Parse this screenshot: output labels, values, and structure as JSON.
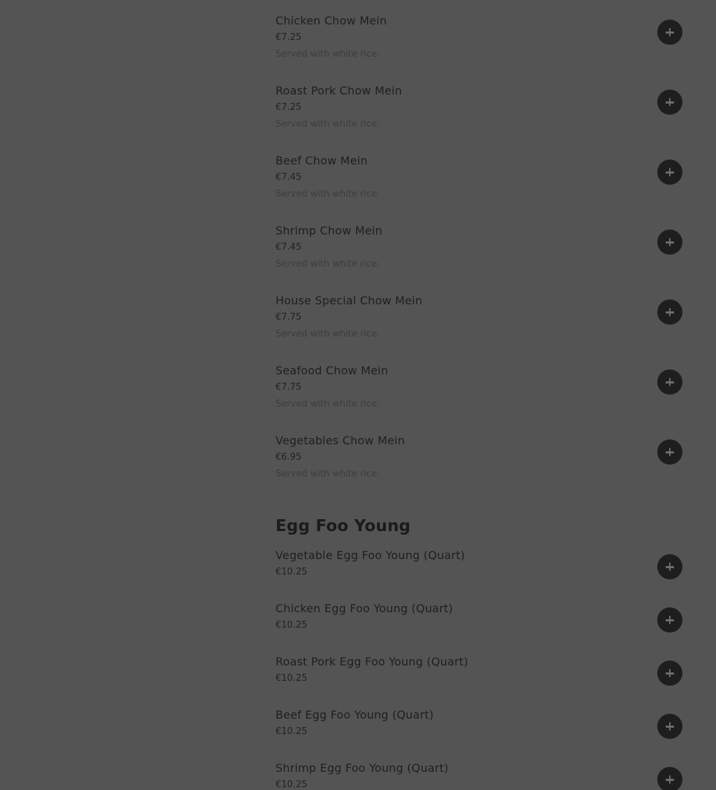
{
  "chow_mein": {
    "items": [
      {
        "name": "Chicken Chow Mein",
        "price": "€7.25",
        "description": "Served with white rice."
      },
      {
        "name": "Roast Pork Chow Mein",
        "price": "€7.25",
        "description": "Served with white rice."
      },
      {
        "name": "Beef Chow Mein",
        "price": "€7.45",
        "description": "Served with white rice."
      },
      {
        "name": "Shrimp Chow Mein",
        "price": "€7.45",
        "description": "Served with white rice."
      },
      {
        "name": "House Special Chow Mein",
        "price": "€7.75",
        "description": "Served with white rice."
      },
      {
        "name": "Seafood Chow Mein",
        "price": "€7.75",
        "description": "Served with white rice."
      },
      {
        "name": "Vegetables Chow Mein",
        "price": "€6.95",
        "description": "Served with white rice."
      }
    ]
  },
  "egg_foo_young": {
    "title": "Egg Foo Young",
    "items": [
      {
        "name": "Vegetable Egg Foo Young (Quart)",
        "price": "€10.25"
      },
      {
        "name": "Chicken Egg Foo Young (Quart)",
        "price": "€10.25"
      },
      {
        "name": "Roast Pork Egg Foo Young (Quart)",
        "price": "€10.25"
      },
      {
        "name": "Beef Egg Foo Young (Quart)",
        "price": "€10.25"
      },
      {
        "name": "Shrimp Egg Foo Young (Quart)",
        "price": "€10.25"
      }
    ]
  },
  "icons": {
    "add": "plus-icon"
  },
  "colors": {
    "overlay_background": "#545454",
    "add_button": "#1e1e1e"
  }
}
